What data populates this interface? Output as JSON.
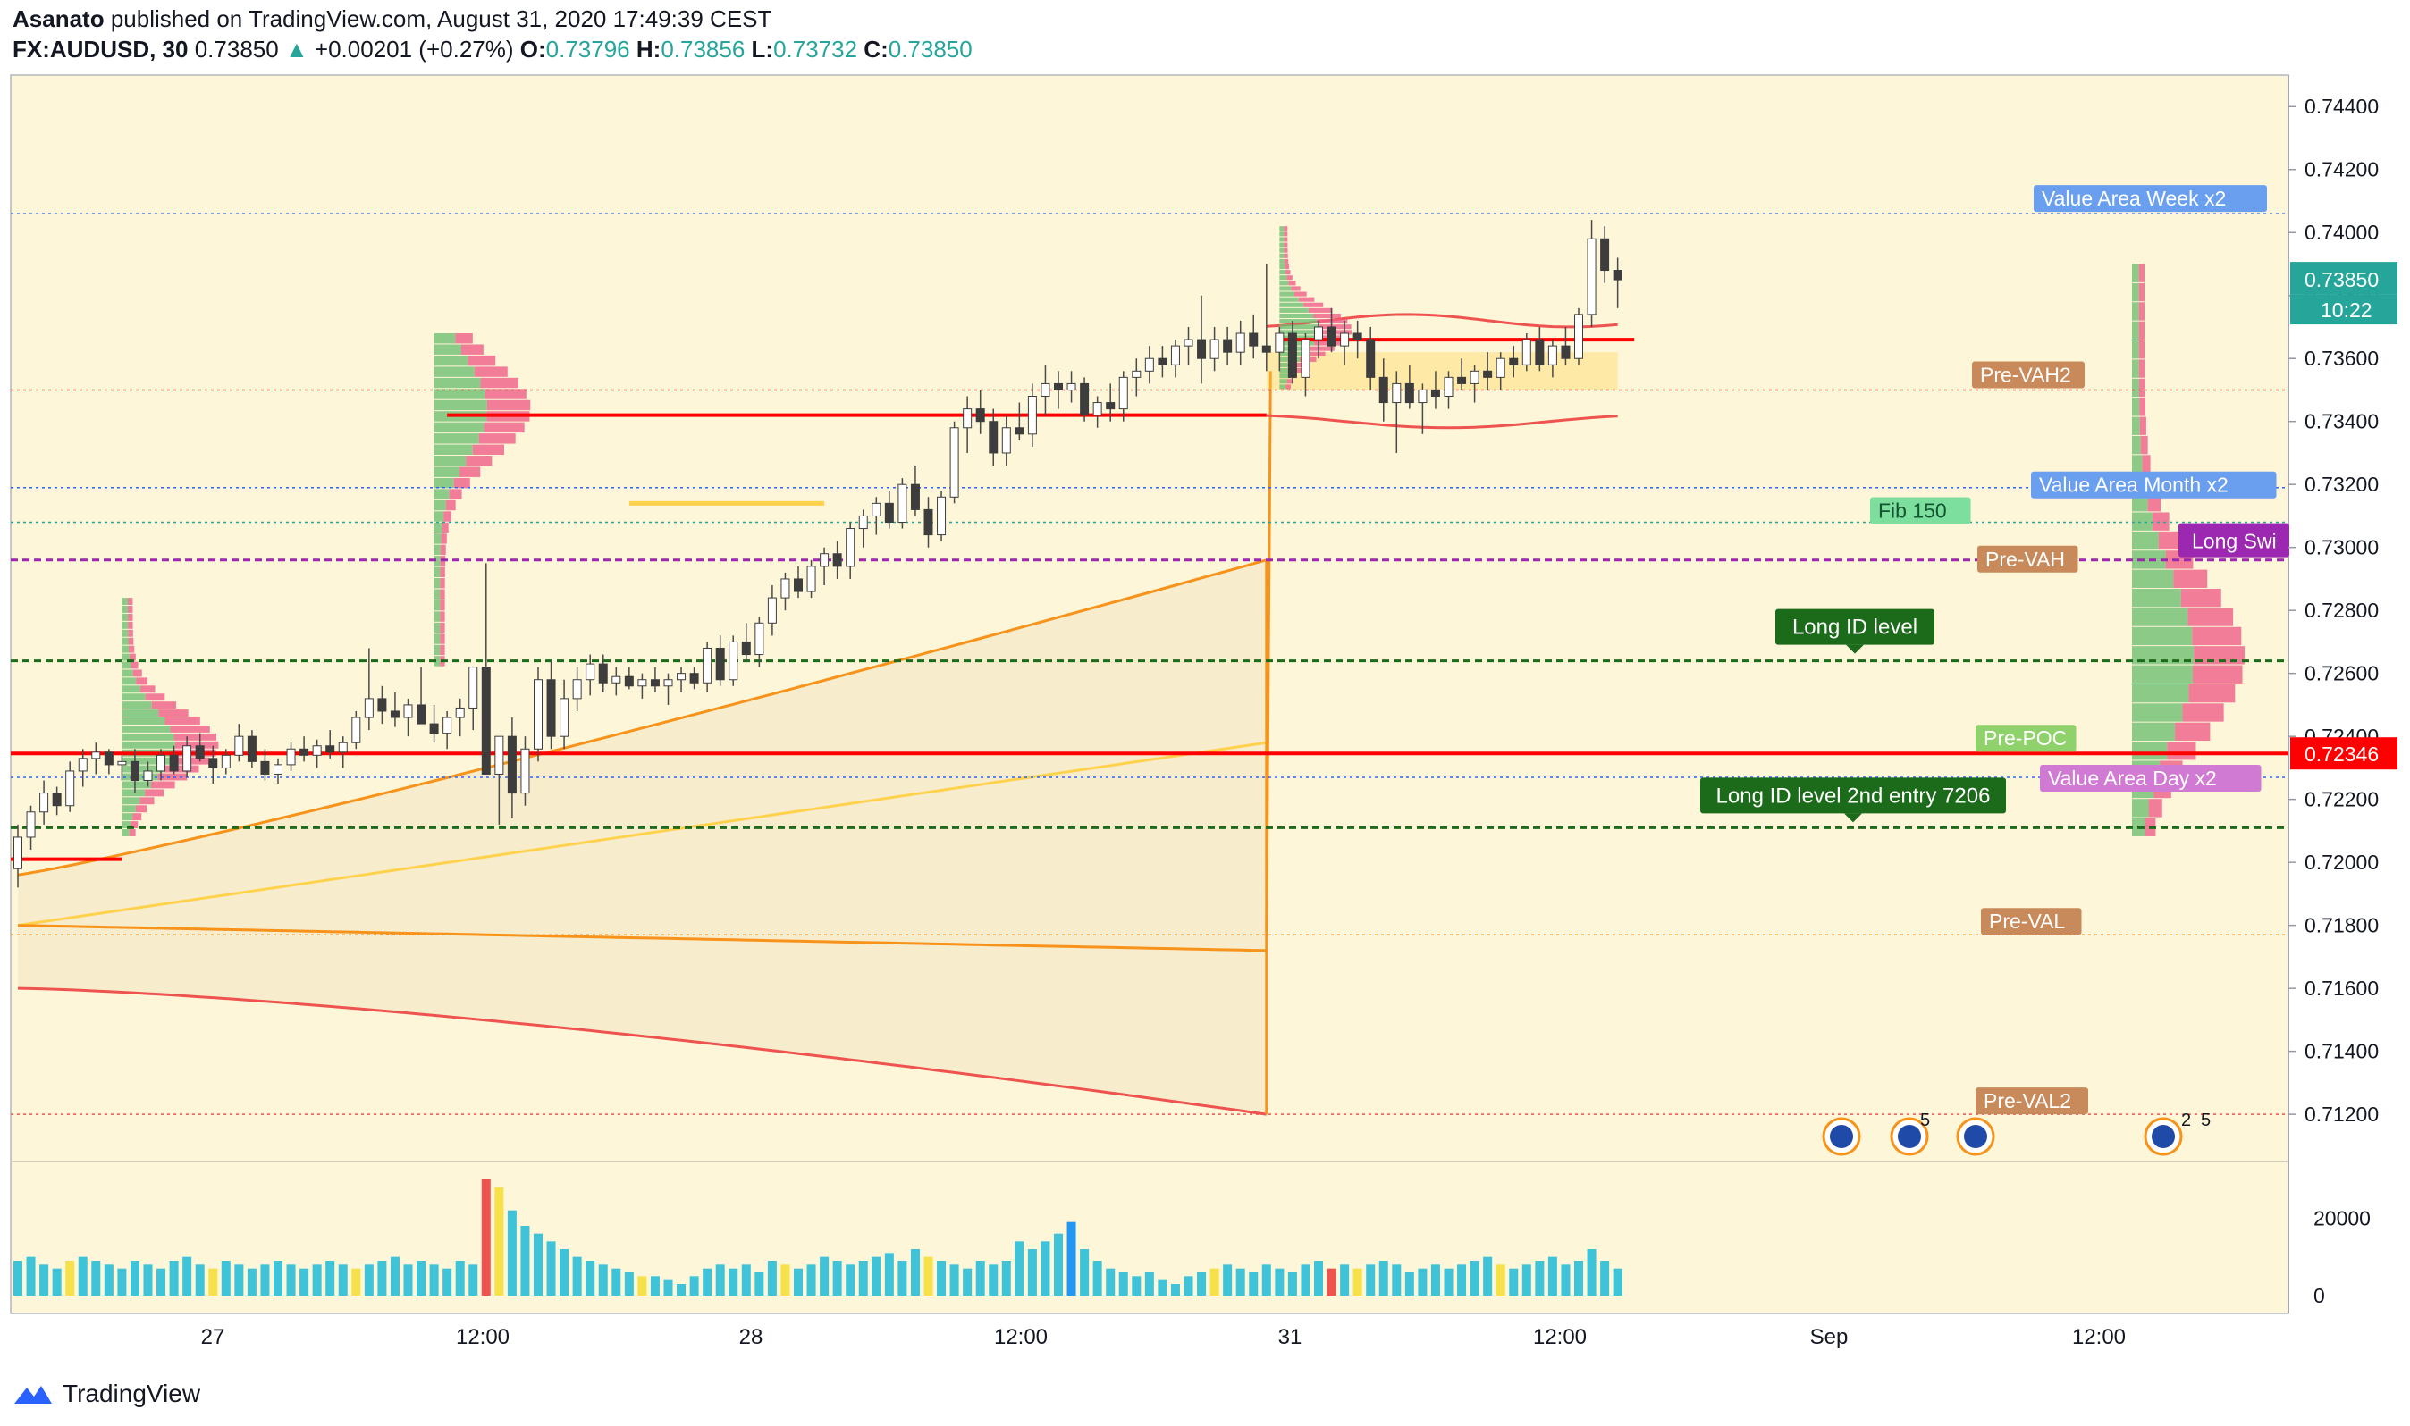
{
  "header": {
    "author": "Asanato",
    "published": "published on TradingView.com, August 31, 2020 17:49:39 CEST",
    "symbol": "FX:AUDUSD, 30",
    "last": "0.73850",
    "arrow": "▲",
    "change": "+0.00201 (+0.27%)",
    "o_label": "O:",
    "o_val": "0.73796",
    "h_label": "H:",
    "h_val": "0.73856",
    "l_label": "L:",
    "l_val": "0.73732",
    "c_label": "C:",
    "c_val": "0.73850"
  },
  "footer": {
    "brand": "TradingView"
  },
  "colors": {
    "background": "#fdf6d8",
    "up": "#26a69a",
    "down": "#ef5350",
    "volume_up": "#3ec3d8",
    "volume_yellow": "#f7e14a",
    "level_red": "#ff0000",
    "level_green": "#1b6b1b",
    "vah_purple": "#9c27b0"
  },
  "chart_data": {
    "type": "candlestick",
    "symbol": "FX:AUDUSD",
    "interval": "30",
    "y_ticks": [
      "0.74400",
      "0.74200",
      "0.74000",
      "0.73800",
      "0.73600",
      "0.73400",
      "0.73200",
      "0.73000",
      "0.72800",
      "0.72600",
      "0.72400",
      "0.72200",
      "0.72000",
      "0.71800",
      "0.71600",
      "0.71400",
      "0.71200"
    ],
    "ylim": [
      0.7105,
      0.745
    ],
    "x_ticks": [
      "27",
      "12:00",
      "28",
      "12:00",
      "31",
      "12:00",
      "Sep",
      "12:00"
    ],
    "last_price_label": "0.73850",
    "countdown": "10:22",
    "poc_price_label": "0.72346",
    "volume_ticks": [
      "20000",
      "0"
    ],
    "volume_max": 30000,
    "candles": [
      [
        0.7198,
        0.7212,
        0.7192,
        0.7208
      ],
      [
        0.7208,
        0.7218,
        0.7204,
        0.7216
      ],
      [
        0.7216,
        0.7226,
        0.7212,
        0.7222
      ],
      [
        0.7222,
        0.7224,
        0.7215,
        0.7218
      ],
      [
        0.7218,
        0.7232,
        0.7216,
        0.7229
      ],
      [
        0.7229,
        0.7236,
        0.7224,
        0.7233
      ],
      [
        0.7233,
        0.7238,
        0.7228,
        0.7235
      ],
      [
        0.7235,
        0.7236,
        0.7228,
        0.7231
      ],
      [
        0.7231,
        0.7234,
        0.7226,
        0.7232
      ],
      [
        0.7232,
        0.7236,
        0.7222,
        0.7226
      ],
      [
        0.7226,
        0.7232,
        0.7224,
        0.7229
      ],
      [
        0.7229,
        0.7236,
        0.7226,
        0.7234
      ],
      [
        0.7234,
        0.7237,
        0.7228,
        0.7229
      ],
      [
        0.7229,
        0.724,
        0.7227,
        0.7237
      ],
      [
        0.7237,
        0.7241,
        0.7232,
        0.7233
      ],
      [
        0.7233,
        0.7237,
        0.7225,
        0.723
      ],
      [
        0.723,
        0.7236,
        0.7228,
        0.7234
      ],
      [
        0.7234,
        0.7244,
        0.7232,
        0.724
      ],
      [
        0.724,
        0.7242,
        0.723,
        0.7232
      ],
      [
        0.7232,
        0.7236,
        0.7226,
        0.7228
      ],
      [
        0.7228,
        0.7233,
        0.7225,
        0.7231
      ],
      [
        0.7231,
        0.7238,
        0.7229,
        0.7236
      ],
      [
        0.7236,
        0.724,
        0.7232,
        0.7234
      ],
      [
        0.7234,
        0.7239,
        0.723,
        0.7237
      ],
      [
        0.7237,
        0.7242,
        0.7233,
        0.7235
      ],
      [
        0.7235,
        0.724,
        0.723,
        0.7238
      ],
      [
        0.7238,
        0.7248,
        0.7236,
        0.7246
      ],
      [
        0.7246,
        0.7268,
        0.7242,
        0.7252
      ],
      [
        0.7252,
        0.7256,
        0.7244,
        0.7248
      ],
      [
        0.7248,
        0.7254,
        0.7243,
        0.7246
      ],
      [
        0.7246,
        0.7252,
        0.724,
        0.725
      ],
      [
        0.725,
        0.7262,
        0.7246,
        0.7244
      ],
      [
        0.7244,
        0.725,
        0.7238,
        0.7241
      ],
      [
        0.7241,
        0.7248,
        0.7236,
        0.7246
      ],
      [
        0.7246,
        0.7252,
        0.724,
        0.7249
      ],
      [
        0.7249,
        0.7262,
        0.7242,
        0.7262
      ],
      [
        0.7262,
        0.7295,
        0.7255,
        0.7228
      ],
      [
        0.7228,
        0.7236,
        0.7212,
        0.724
      ],
      [
        0.724,
        0.7246,
        0.7214,
        0.7222
      ],
      [
        0.7222,
        0.724,
        0.7218,
        0.7236
      ],
      [
        0.7236,
        0.7262,
        0.7232,
        0.7258
      ],
      [
        0.7258,
        0.7264,
        0.7236,
        0.724
      ],
      [
        0.724,
        0.7258,
        0.7236,
        0.7252
      ],
      [
        0.7252,
        0.7262,
        0.7248,
        0.7258
      ],
      [
        0.7258,
        0.7266,
        0.7253,
        0.7263
      ],
      [
        0.7263,
        0.7266,
        0.7254,
        0.7257
      ],
      [
        0.7257,
        0.7262,
        0.7253,
        0.7259
      ],
      [
        0.7259,
        0.7262,
        0.7255,
        0.7256
      ],
      [
        0.7256,
        0.726,
        0.7252,
        0.7258
      ],
      [
        0.7258,
        0.7262,
        0.7254,
        0.7256
      ],
      [
        0.7256,
        0.726,
        0.725,
        0.7258
      ],
      [
        0.7258,
        0.7262,
        0.7254,
        0.726
      ],
      [
        0.726,
        0.7262,
        0.7255,
        0.7257
      ],
      [
        0.7257,
        0.727,
        0.7254,
        0.7268
      ],
      [
        0.7268,
        0.7272,
        0.7256,
        0.7258
      ],
      [
        0.7258,
        0.7272,
        0.7256,
        0.727
      ],
      [
        0.727,
        0.7276,
        0.7264,
        0.7266
      ],
      [
        0.7266,
        0.7278,
        0.7262,
        0.7276
      ],
      [
        0.7276,
        0.7288,
        0.7272,
        0.7284
      ],
      [
        0.7284,
        0.7292,
        0.728,
        0.729
      ],
      [
        0.729,
        0.7294,
        0.7284,
        0.7286
      ],
      [
        0.7286,
        0.7296,
        0.7284,
        0.7294
      ],
      [
        0.7294,
        0.73,
        0.7288,
        0.7298
      ],
      [
        0.7298,
        0.7302,
        0.729,
        0.7294
      ],
      [
        0.7294,
        0.7308,
        0.729,
        0.7306
      ],
      [
        0.7306,
        0.7312,
        0.73,
        0.731
      ],
      [
        0.731,
        0.7316,
        0.7304,
        0.7314
      ],
      [
        0.7314,
        0.7318,
        0.7306,
        0.7308
      ],
      [
        0.7308,
        0.7322,
        0.7306,
        0.732
      ],
      [
        0.732,
        0.7326,
        0.731,
        0.7312
      ],
      [
        0.7312,
        0.7316,
        0.73,
        0.7304
      ],
      [
        0.7304,
        0.7318,
        0.7302,
        0.7316
      ],
      [
        0.7316,
        0.734,
        0.7314,
        0.7338
      ],
      [
        0.7338,
        0.7348,
        0.733,
        0.7344
      ],
      [
        0.7344,
        0.735,
        0.7336,
        0.734
      ],
      [
        0.734,
        0.7344,
        0.7326,
        0.733
      ],
      [
        0.733,
        0.7342,
        0.7326,
        0.7338
      ],
      [
        0.7338,
        0.7346,
        0.7334,
        0.7336
      ],
      [
        0.7336,
        0.7352,
        0.7332,
        0.7348
      ],
      [
        0.7348,
        0.7358,
        0.7342,
        0.7352
      ],
      [
        0.7352,
        0.7356,
        0.7344,
        0.735
      ],
      [
        0.735,
        0.7356,
        0.7346,
        0.7352
      ],
      [
        0.7352,
        0.7354,
        0.734,
        0.7342
      ],
      [
        0.7342,
        0.7348,
        0.7338,
        0.7346
      ],
      [
        0.7346,
        0.7352,
        0.734,
        0.7344
      ],
      [
        0.7344,
        0.7356,
        0.734,
        0.7354
      ],
      [
        0.7354,
        0.736,
        0.7348,
        0.7356
      ],
      [
        0.7356,
        0.7364,
        0.7352,
        0.736
      ],
      [
        0.736,
        0.7364,
        0.7354,
        0.7358
      ],
      [
        0.7358,
        0.7366,
        0.7354,
        0.7364
      ],
      [
        0.7364,
        0.737,
        0.7358,
        0.7366
      ],
      [
        0.7366,
        0.738,
        0.7352,
        0.736
      ],
      [
        0.736,
        0.737,
        0.7356,
        0.7366
      ],
      [
        0.7366,
        0.737,
        0.7358,
        0.7362
      ],
      [
        0.7362,
        0.7372,
        0.7358,
        0.7368
      ],
      [
        0.7368,
        0.7374,
        0.736,
        0.7364
      ],
      [
        0.7364,
        0.739,
        0.7356,
        0.7362
      ],
      [
        0.7362,
        0.737,
        0.7356,
        0.7368
      ],
      [
        0.7368,
        0.7372,
        0.7352,
        0.7354
      ],
      [
        0.7354,
        0.7368,
        0.7348,
        0.7366
      ],
      [
        0.7366,
        0.7372,
        0.736,
        0.737
      ],
      [
        0.737,
        0.7376,
        0.7362,
        0.7364
      ],
      [
        0.7364,
        0.7372,
        0.7358,
        0.7368
      ],
      [
        0.7368,
        0.7372,
        0.736,
        0.7366
      ],
      [
        0.7366,
        0.737,
        0.735,
        0.7354
      ],
      [
        0.7354,
        0.736,
        0.734,
        0.7346
      ],
      [
        0.7346,
        0.7356,
        0.733,
        0.7352
      ],
      [
        0.7352,
        0.7358,
        0.7344,
        0.7346
      ],
      [
        0.7346,
        0.7352,
        0.7336,
        0.735
      ],
      [
        0.735,
        0.7356,
        0.7344,
        0.7348
      ],
      [
        0.7348,
        0.7356,
        0.7344,
        0.7354
      ],
      [
        0.7354,
        0.736,
        0.735,
        0.7352
      ],
      [
        0.7352,
        0.7358,
        0.7346,
        0.7356
      ],
      [
        0.7356,
        0.7362,
        0.735,
        0.7354
      ],
      [
        0.7354,
        0.7362,
        0.735,
        0.736
      ],
      [
        0.736,
        0.7364,
        0.7354,
        0.7358
      ],
      [
        0.7358,
        0.7368,
        0.7356,
        0.7366
      ],
      [
        0.7366,
        0.737,
        0.7356,
        0.7358
      ],
      [
        0.7358,
        0.7366,
        0.7354,
        0.7364
      ],
      [
        0.7364,
        0.737,
        0.7358,
        0.736
      ],
      [
        0.736,
        0.7376,
        0.7358,
        0.7374
      ],
      [
        0.7374,
        0.7404,
        0.737,
        0.7398
      ],
      [
        0.7398,
        0.7402,
        0.7384,
        0.7388
      ],
      [
        0.7388,
        0.7392,
        0.7376,
        0.7385
      ]
    ],
    "volumes": [
      9000,
      10000,
      8000,
      7000,
      9000,
      10000,
      9000,
      8000,
      7000,
      9000,
      8000,
      7000,
      9000,
      10000,
      8000,
      7000,
      9000,
      8000,
      7000,
      8000,
      9000,
      8000,
      7000,
      8000,
      9000,
      8000,
      7000,
      8000,
      9000,
      10000,
      8000,
      9000,
      8000,
      7000,
      9000,
      8000,
      30000,
      28000,
      22000,
      18000,
      16000,
      14000,
      12000,
      10000,
      9000,
      8000,
      7000,
      6000,
      5000,
      5000,
      4000,
      3000,
      5000,
      7000,
      8000,
      7000,
      8000,
      6000,
      9000,
      8000,
      7000,
      8000,
      10000,
      9000,
      8000,
      9000,
      10000,
      11000,
      9000,
      12000,
      10000,
      9000,
      8000,
      7000,
      9000,
      8000,
      9000,
      14000,
      12000,
      14000,
      16000,
      19000,
      12000,
      9000,
      7000,
      6000,
      5000,
      6000,
      4000,
      3000,
      5000,
      6000,
      7000,
      8000,
      7000,
      6000,
      8000,
      7000,
      6000,
      8000,
      9000,
      7000,
      8000,
      7000,
      8000,
      9000,
      8000,
      6000,
      7000,
      8000,
      7000,
      8000,
      9000,
      10000,
      8000,
      7000,
      8000,
      9000,
      10000,
      8000,
      9000,
      12000,
      9000,
      7000
    ],
    "horizontal_levels": [
      {
        "label": "Value Area Week x2",
        "price": 0.7406
      },
      {
        "label": "Pre-VAH2",
        "price": 0.735
      },
      {
        "label": "Value Area Month x2",
        "price": 0.7319
      },
      {
        "label": "Fib 150",
        "price": 0.7308
      },
      {
        "label": "Pre-VAH",
        "price": 0.7296
      },
      {
        "label": "Long ID level",
        "price": 0.7264
      },
      {
        "label": "Pre-POC",
        "price": 0.72346
      },
      {
        "label": "Value Area Day x2",
        "price": 0.7227
      },
      {
        "label": "Long ID level 2nd entry 7206",
        "price": 0.7211
      },
      {
        "label": "Pre-VAL",
        "price": 0.7177
      },
      {
        "label": "Pre-VAL2",
        "price": 0.712
      }
    ],
    "long_swing_label": "Long Swi",
    "event_badge_5a": "5",
    "event_badge_5b": "5",
    "event_badge_2": "2"
  }
}
